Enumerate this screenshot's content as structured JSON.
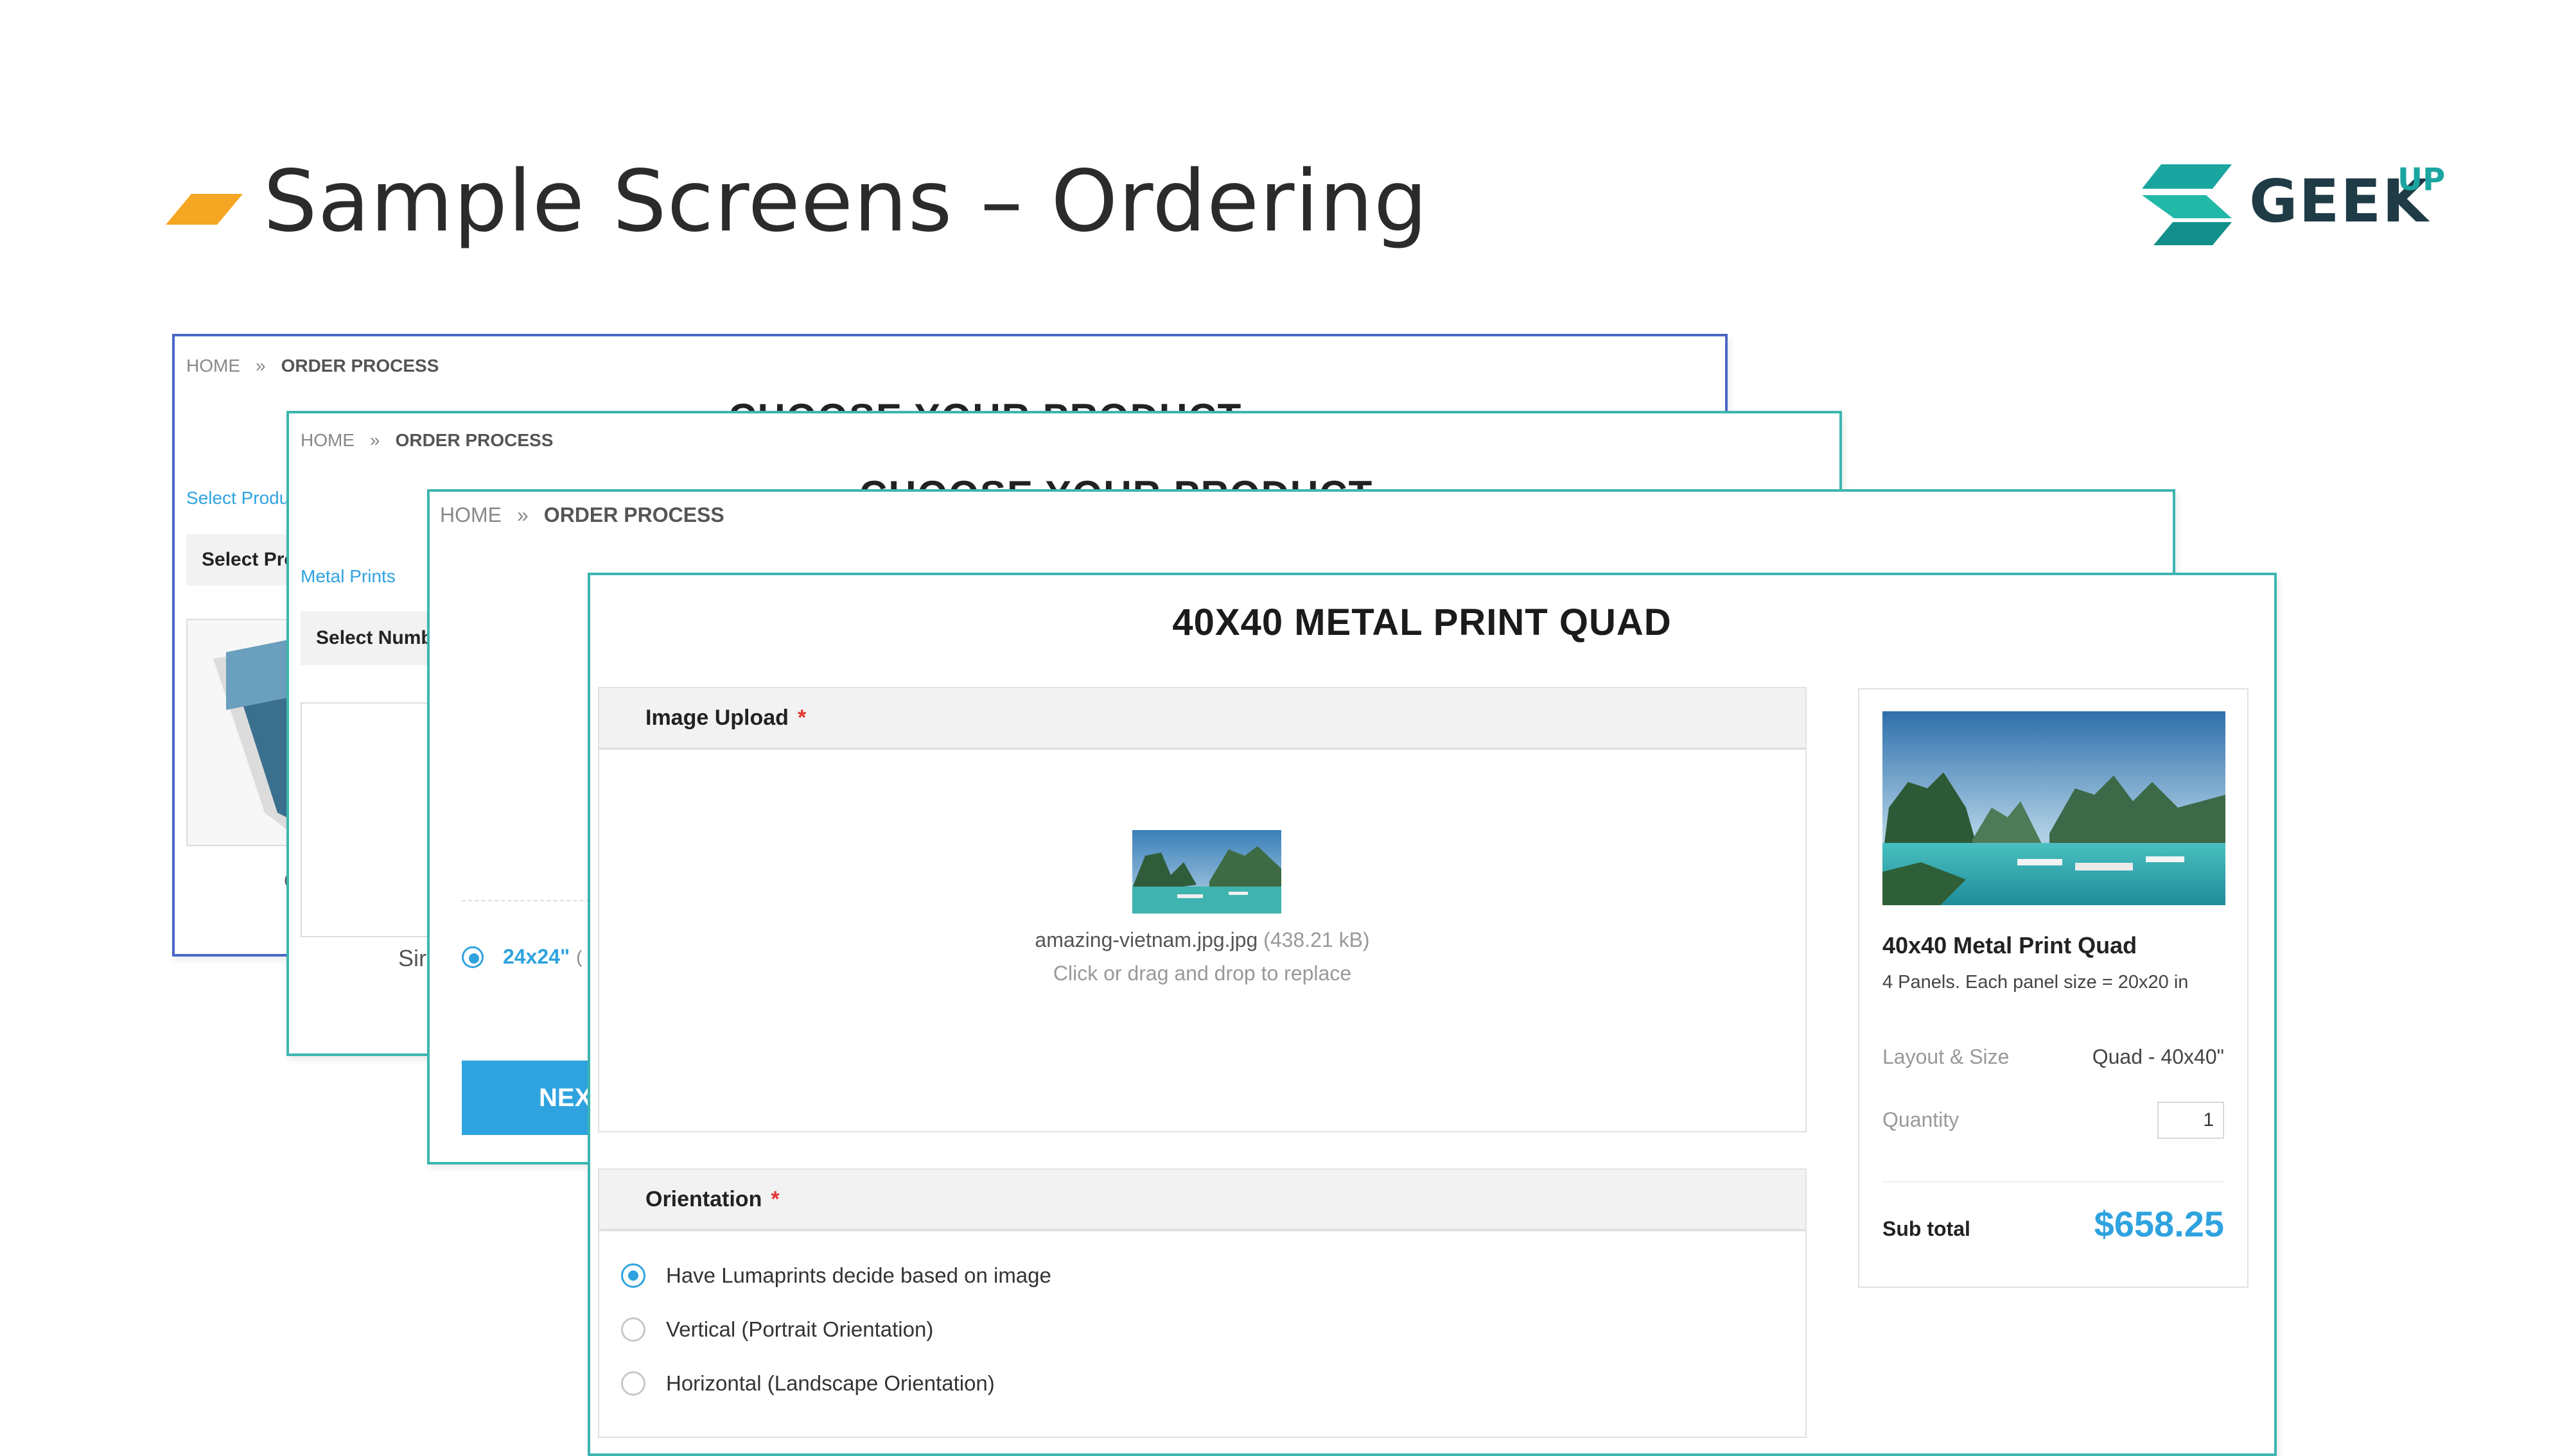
{
  "slide": {
    "title": "Sample Screens – Ordering",
    "logo_text": "GEEK",
    "logo_superscript": "UP",
    "accent_color": "#f5a623"
  },
  "screen1": {
    "breadcrumb": {
      "home": "HOME",
      "current": "ORDER PROCESS"
    },
    "heading_fragment": "CHOOSE YOUR PRODUCT",
    "link_fragment": "Select Produ",
    "bar_fragment": "Select Pro",
    "caption_fragment": "C"
  },
  "screen2": {
    "breadcrumb": {
      "home": "HOME",
      "current": "ORDER PROCESS"
    },
    "heading_fragment": "CHOOSE YOUR PRODUCT",
    "link_fragment": "Metal Prints",
    "bar_fragment": "Select Numb",
    "caption_fragment": "Sir"
  },
  "screen3": {
    "breadcrumb": {
      "home": "HOME",
      "current": "ORDER PROCESS"
    },
    "size_option": "24x24\"",
    "size_option_extra": "(",
    "next_button": "NEX"
  },
  "screen4": {
    "title": "40X40 METAL PRINT QUAD",
    "upload": {
      "label": "Image Upload",
      "required_mark": "*",
      "file_name": "amazing-vietnam.jpg.jpg",
      "file_size": "(438.21 kB)",
      "hint": "Click or drag and drop to replace"
    },
    "orientation": {
      "label": "Orientation",
      "required_mark": "*",
      "options": [
        {
          "label": "Have Lumaprints decide based on image",
          "selected": true
        },
        {
          "label": "Vertical (Portrait Orientation)",
          "selected": false
        },
        {
          "label": "Horizontal (Landscape Orientation)",
          "selected": false
        }
      ]
    },
    "summary": {
      "product_name": "40x40 Metal Print Quad",
      "description": "4 Panels. Each panel size = 20x20 in",
      "layout_label": "Layout & Size",
      "layout_value": "Quad - 40x40\"",
      "quantity_label": "Quantity",
      "quantity_value": "1",
      "subtotal_label": "Sub total",
      "subtotal_value": "$658.25"
    }
  },
  "colors": {
    "brand_blue": "#2fa3df",
    "teal_border": "#3db5b0",
    "indigo_border": "#4a66c6",
    "required_red": "#e3342f"
  }
}
